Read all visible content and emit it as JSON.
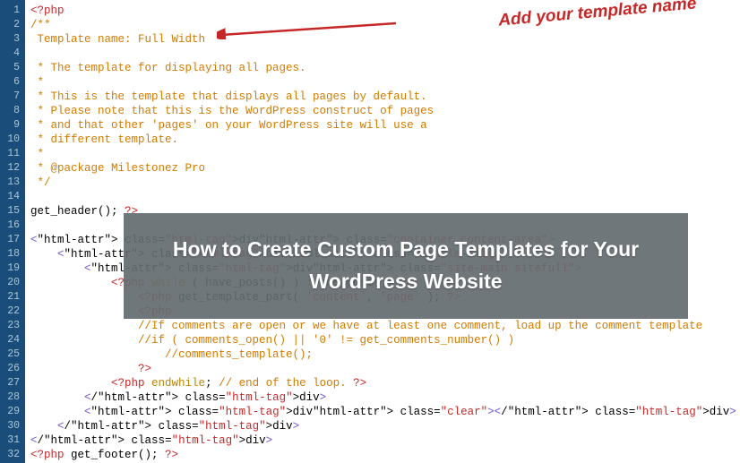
{
  "annotation": "Add your template name",
  "overlay_title": "How to Create Custom Page Templates for Your WordPress Website",
  "lines": [
    {
      "n": 1,
      "c": "<?php",
      "cls": "php-tag"
    },
    {
      "n": 2,
      "c": "/**",
      "cls": "comment"
    },
    {
      "n": 3,
      "c": " Template name: Full Width",
      "cls": "comment"
    },
    {
      "n": 4,
      "c": "",
      "cls": ""
    },
    {
      "n": 5,
      "c": " * The template for displaying all pages.",
      "cls": "comment"
    },
    {
      "n": 6,
      "c": " *",
      "cls": "comment"
    },
    {
      "n": 7,
      "c": " * This is the template that displays all pages by default.",
      "cls": "comment"
    },
    {
      "n": 8,
      "c": " * Please note that this is the WordPress construct of pages",
      "cls": "comment"
    },
    {
      "n": 9,
      "c": " * and that other 'pages' on your WordPress site will use a",
      "cls": "comment"
    },
    {
      "n": 10,
      "c": " * different template.",
      "cls": "comment"
    },
    {
      "n": 11,
      "c": " *",
      "cls": "comment"
    },
    {
      "n": 12,
      "c": " * @package Milestonez Pro",
      "cls": "comment"
    },
    {
      "n": 13,
      "c": " */",
      "cls": "comment"
    },
    {
      "n": 14,
      "c": "",
      "cls": ""
    },
    {
      "n": 15,
      "c": "get_header(); ?>",
      "cls": ""
    },
    {
      "n": 16,
      "c": "",
      "cls": ""
    },
    {
      "n": 17,
      "c": "<div class=\"container content-area\">",
      "cls": "html"
    },
    {
      "n": 18,
      "c": "    <div class=\"middle-align\">",
      "cls": "html"
    },
    {
      "n": 19,
      "c": "        <div class=\"site-main sitefull\">",
      "cls": "html"
    },
    {
      "n": 20,
      "c": "            <?php while ( have_posts() ) : the_post(); ?>",
      "cls": "php"
    },
    {
      "n": 21,
      "c": "                <?php get_template_part( 'content', 'page' ); ?>",
      "cls": "php"
    },
    {
      "n": 22,
      "c": "                <?php",
      "cls": "php-tag"
    },
    {
      "n": 23,
      "c": "                //If comments are open or we have at least one comment, load up the comment template",
      "cls": "comment"
    },
    {
      "n": 24,
      "c": "                //if ( comments_open() || '0' != get_comments_number() )",
      "cls": "comment"
    },
    {
      "n": 25,
      "c": "                    //comments_template();",
      "cls": "comment"
    },
    {
      "n": 26,
      "c": "                ?>",
      "cls": "php-tag"
    },
    {
      "n": 27,
      "c": "            <?php endwhile; // end of the loop. ?>",
      "cls": "php"
    },
    {
      "n": 28,
      "c": "        </div>",
      "cls": "html"
    },
    {
      "n": 29,
      "c": "        <div class=\"clear\"></div>",
      "cls": "html"
    },
    {
      "n": 30,
      "c": "    </div>",
      "cls": "html"
    },
    {
      "n": 31,
      "c": "</div>",
      "cls": "html"
    },
    {
      "n": 32,
      "c": "<?php get_footer(); ?>",
      "cls": "php"
    }
  ]
}
